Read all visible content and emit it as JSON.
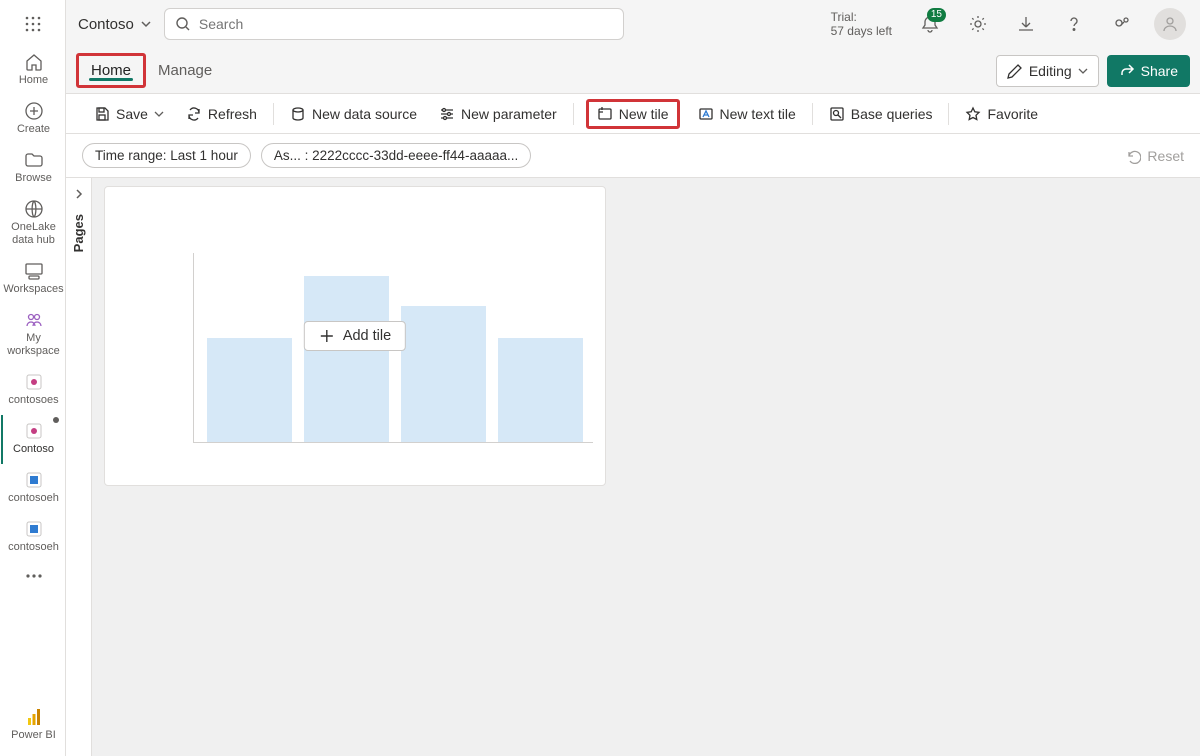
{
  "brand": {
    "name": "Contoso"
  },
  "search": {
    "placeholder": "Search"
  },
  "trial": {
    "line1": "Trial:",
    "line2": "57 days left"
  },
  "alerts": {
    "count": "15"
  },
  "leftRail": {
    "home": "Home",
    "create": "Create",
    "browse": "Browse",
    "onelake": "OneLake data hub",
    "workspaces": "Workspaces",
    "myworkspace": "My workspace",
    "contosoes": "contosoes",
    "contoso": "Contoso",
    "contosoeh1": "contosoeh",
    "contosoeh2": "contosoeh",
    "powerbi": "Power BI"
  },
  "tabs": {
    "home": "Home",
    "manage": "Manage"
  },
  "buttons": {
    "editing": "Editing",
    "share": "Share"
  },
  "toolbar": {
    "save": "Save",
    "refresh": "Refresh",
    "newDataSource": "New data source",
    "newParameter": "New parameter",
    "newTile": "New tile",
    "newTextTile": "New text tile",
    "baseQueries": "Base queries",
    "favorite": "Favorite"
  },
  "filters": {
    "timeRange": "Time range: Last 1 hour",
    "asLabel": "As... : 2222cccc-33dd-eeee-ff44-aaaaa...",
    "reset": "Reset"
  },
  "pages": {
    "label": "Pages"
  },
  "tile": {
    "addTile": "Add tile"
  },
  "chart_data": {
    "type": "bar",
    "categories": [
      "",
      "",
      "",
      ""
    ],
    "values": [
      55,
      88,
      72,
      55
    ],
    "title": "",
    "xlabel": "",
    "ylabel": "",
    "ylim": [
      0,
      100
    ]
  }
}
